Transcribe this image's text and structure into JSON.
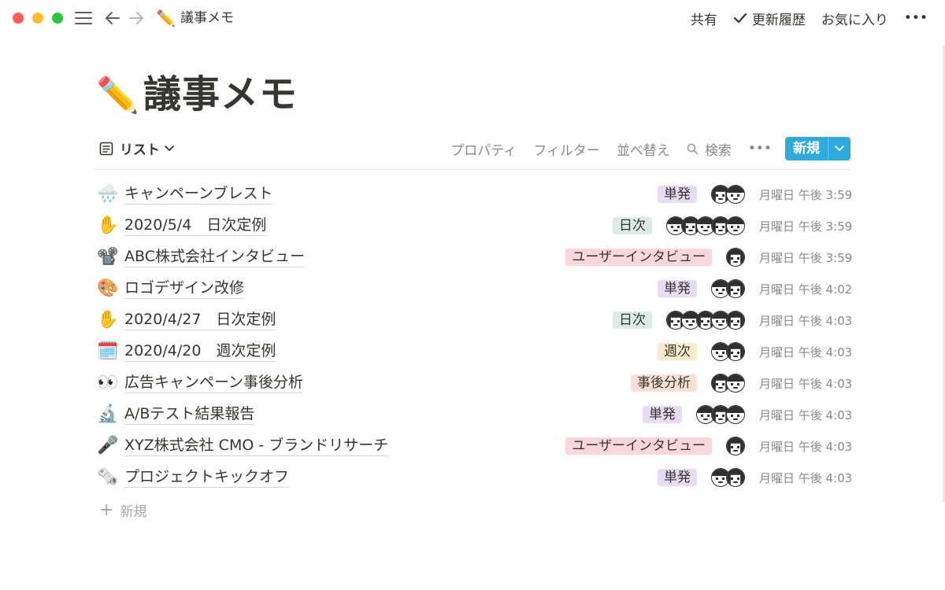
{
  "window": {
    "controls": [
      "close",
      "minimize",
      "maximize"
    ]
  },
  "topbar": {
    "page_emoji": "✏️",
    "page_title": "議事メモ",
    "share_label": "共有",
    "updates_label": "更新履歴",
    "favorite_label": "お気に入り",
    "more_label": "•••"
  },
  "page": {
    "emoji": "✏️",
    "title": "議事メモ"
  },
  "view": {
    "name": "リスト",
    "properties_label": "プロパティ",
    "filter_label": "フィルター",
    "sort_label": "並べ替え",
    "search_label": "検索",
    "more_label": "•••",
    "new_label": "新規"
  },
  "rows": [
    {
      "emoji": "🌧️",
      "title": "キャンペーンブレスト",
      "tag": "単発",
      "tag_color": "#e7dcf5",
      "avatars": 2,
      "time": "月曜日 午後 3:59"
    },
    {
      "emoji": "✋",
      "title": "2020/5/4　日次定例",
      "tag": "日次",
      "tag_color": "#dbebe7",
      "avatars": 5,
      "time": "月曜日 午後 3:59"
    },
    {
      "emoji": "📽️",
      "title": "ABC株式会社インタビュー",
      "tag": "ユーザーインタビュー",
      "tag_color": "#fbd7d9",
      "avatars": 1,
      "time": "月曜日 午後 3:59"
    },
    {
      "emoji": "🎨",
      "title": "ロゴデザイン改修",
      "tag": "単発",
      "tag_color": "#e7dcf5",
      "avatars": 2,
      "time": "月曜日 午後 4:02"
    },
    {
      "emoji": "✋",
      "title": "2020/4/27　日次定例",
      "tag": "日次",
      "tag_color": "#dbebe7",
      "avatars": 5,
      "time": "月曜日 午後 4:03"
    },
    {
      "emoji": "🗓️",
      "title": "2020/4/20　週次定例",
      "tag": "週次",
      "tag_color": "#fbeacb",
      "avatars": 2,
      "time": "月曜日 午後 4:03"
    },
    {
      "emoji": "👀",
      "title": "広告キャンペーン事後分析",
      "tag": "事後分析",
      "tag_color": "#fbe1d3",
      "avatars": 2,
      "time": "月曜日 午後 4:03"
    },
    {
      "emoji": "🔬",
      "title": "A/Bテスト結果報告",
      "tag": "単発",
      "tag_color": "#e7dcf5",
      "avatars": 3,
      "time": "月曜日 午後 4:03"
    },
    {
      "emoji": "🎤",
      "title": "XYZ株式会社 CMO - ブランドリサーチ",
      "tag": "ユーザーインタビュー",
      "tag_color": "#fbd7d9",
      "avatars": 1,
      "time": "月曜日 午後 4:03"
    },
    {
      "emoji": "🗞️",
      "title": "プロジェクトキックオフ",
      "tag": "単発",
      "tag_color": "#e7dcf5",
      "avatars": 2,
      "time": "月曜日 午後 4:03"
    }
  ],
  "add_new_label": "新規"
}
